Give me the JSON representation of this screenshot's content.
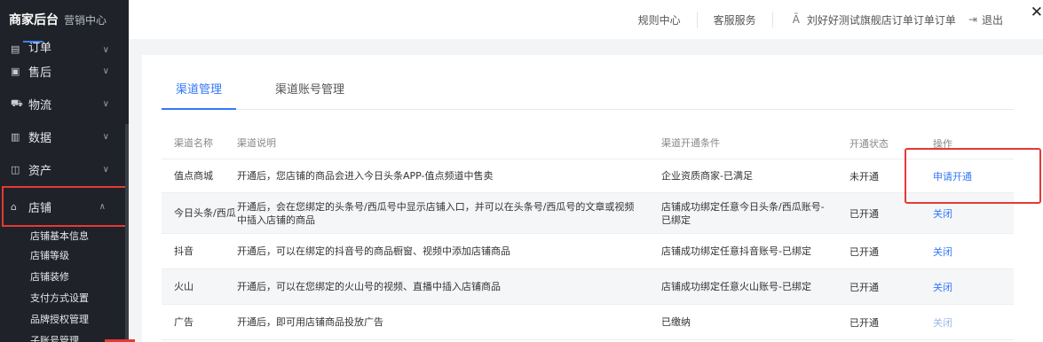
{
  "brand": {
    "title": "商家后台",
    "subtitle": "营销中心"
  },
  "sidebar": {
    "menu": [
      {
        "label": "订单",
        "icon": "order-icon"
      },
      {
        "label": "售后",
        "icon": "after-sale-icon"
      },
      {
        "label": "物流",
        "icon": "logistics-icon"
      },
      {
        "label": "数据",
        "icon": "data-icon"
      },
      {
        "label": "资产",
        "icon": "asset-icon"
      },
      {
        "label": "店铺",
        "icon": "shop-icon"
      }
    ],
    "shop_sub": [
      "店铺基本信息",
      "店铺等级",
      "店铺装修",
      "支付方式设置",
      "品牌授权管理",
      "子账号管理"
    ]
  },
  "header": {
    "rules": "规则中心",
    "service": "客服服务",
    "user": "刘好好测试旗舰店订单订单订单",
    "logout": "退出"
  },
  "tabs": [
    "渠道管理",
    "渠道账号管理"
  ],
  "table": {
    "columns": [
      "渠道名称",
      "渠道说明",
      "渠道开通条件",
      "开通状态",
      "操作"
    ],
    "rows": [
      {
        "name": "值点商城",
        "desc": "开通后，您店铺的商品会进入今日头条APP-值点频道中售卖",
        "cond": "企业资质商家-已满足",
        "status": "未开通",
        "action": "申请开通"
      },
      {
        "name": "今日头条/西瓜",
        "desc": "开通后，会在您绑定的头条号/西瓜号中显示店铺入口，并可以在头条号/西瓜号的文章或视频中插入店铺的商品",
        "cond": "店铺成功绑定任意今日头条/西瓜账号-已绑定",
        "status": "已开通",
        "action": "关闭"
      },
      {
        "name": "抖音",
        "desc": "开通后，可以在绑定的抖音号的商品橱窗、视频中添加店铺商品",
        "cond": "店铺成功绑定任意抖音账号-已绑定",
        "status": "已开通",
        "action": "关闭"
      },
      {
        "name": "火山",
        "desc": "开通后，可以在您绑定的火山号的视频、直播中插入店铺商品",
        "cond": "店铺成功绑定任意火山账号-已绑定",
        "status": "已开通",
        "action": "关闭"
      },
      {
        "name": "广告",
        "desc": "开通后，即可用店铺商品投放广告",
        "cond": "已缴纳",
        "status": "已开通",
        "action": "关闭"
      }
    ]
  },
  "colors": {
    "accent": "#3478f6",
    "sidebar_bg": "#1f2329",
    "highlight": "#e53935"
  }
}
